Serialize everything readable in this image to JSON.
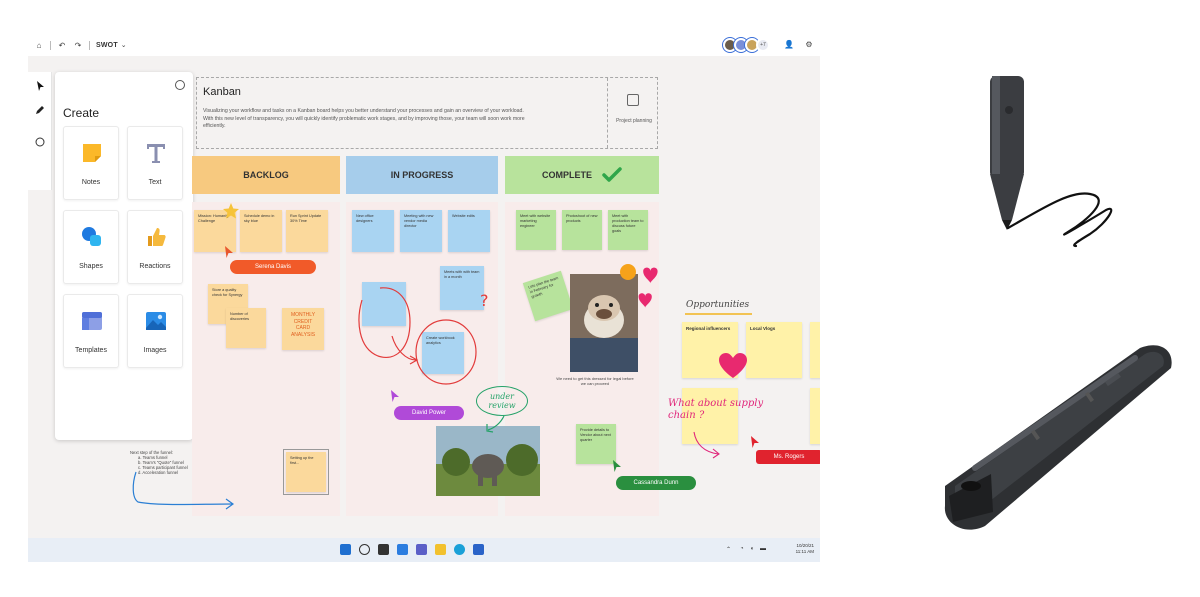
{
  "topbar": {
    "title": "SWOT",
    "avatar_overflow": "+7"
  },
  "toolbar": {
    "tools": [
      "select-arrow",
      "pen",
      "lasso"
    ]
  },
  "create_panel": {
    "title": "Create",
    "tiles": [
      {
        "label": "Notes",
        "icon": "notes-icon"
      },
      {
        "label": "Text",
        "icon": "text-icon"
      },
      {
        "label": "Shapes",
        "icon": "shapes-icon"
      },
      {
        "label": "Reactions",
        "icon": "thumbs-up-icon"
      },
      {
        "label": "Templates",
        "icon": "templates-icon"
      },
      {
        "label": "Images",
        "icon": "image-icon"
      }
    ]
  },
  "kanban": {
    "title": "Kanban",
    "description": "Visualizing your workflow and tasks on a Kanban board helps you better understand your processes and gain an overview of your workload. With this new level of transparency, you will quickly identify problematic work stages, and by improving those, your team will soon work more efficiently.",
    "project_label": "Project planning",
    "columns": [
      {
        "title": "BACKLOG",
        "color": "#f7c97f"
      },
      {
        "title": "IN PROGRESS",
        "color": "#a6cdeb"
      },
      {
        "title": "COMPLETE",
        "color": "#b8e39c"
      }
    ]
  },
  "backlog": {
    "stickies": [
      "Mission: Humanity Challenge",
      "Schedule demo in sky blue",
      "Run Sprint Update 30% Time"
    ],
    "user": "Serena Davis",
    "stickies2": [
      "Store a quality check for Synergy",
      "Number of discoveries"
    ],
    "handwriting": "MONTHLY CREDIT CARD ANALYSIS",
    "checklist": [
      "Next step of the funnel:",
      "a. Teams funnel",
      "b. Team's \"Quote\" funnel",
      "c. Teams participant funnel",
      "d. Acceleration funnel"
    ],
    "note_bottom": "Setting up the first..."
  },
  "progress": {
    "stickies": [
      "New office designers",
      "Meeting with new vendor media director",
      "Website edits"
    ],
    "sticky_mid": "Meets with with team in a month",
    "sticky_circled": "Create workbook analytics",
    "user": "David Power",
    "handwriting": "under review"
  },
  "complete": {
    "stickies": [
      "Meet with website marketing engineer",
      "Photoshoot of new products",
      "Meet with production team to discuss future goals"
    ],
    "sticky_tilted": "Lets plan the team in February for growth",
    "photo_caption": "We need to get this dressed for legal before we can proceed",
    "sticky_bottom": "Provide details to Vendor about next quarter",
    "user": "Cassandra Dunn"
  },
  "opportunities": {
    "title": "Opportunities",
    "stickies": [
      "Regional influencers",
      "Local Vlogs"
    ],
    "handwriting": "What about supply chain ?",
    "user": "Ms. Rogers"
  },
  "taskbar": {
    "date": "10/20/21",
    "time": "11:11 AM"
  }
}
